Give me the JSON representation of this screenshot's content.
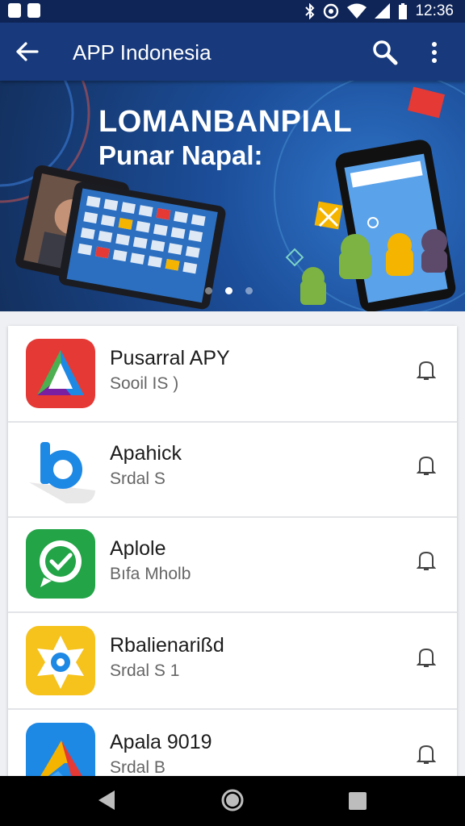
{
  "status_bar": {
    "time": "12:36"
  },
  "app_bar": {
    "title": "APP Indonesia"
  },
  "banner": {
    "headline": "LOMANBANPIAL",
    "subheadline": "Punar Napal:",
    "active_page": 2,
    "page_count": 3
  },
  "apps": [
    {
      "name": "Pusarral APY",
      "subtitle": "Sooil IS )"
    },
    {
      "name": "Apahick",
      "subtitle": "Srdal S"
    },
    {
      "name": "Aplole",
      "subtitle": "Bıfa Mholb"
    },
    {
      "name": "Rbalienarißd",
      "subtitle": "Srdal S 1"
    },
    {
      "name": "Apala 9019",
      "subtitle": "Srdal B"
    }
  ],
  "colors": {
    "status_bar": "#0f2557",
    "app_bar": "#183a7c",
    "accent": "#1e88e5"
  }
}
